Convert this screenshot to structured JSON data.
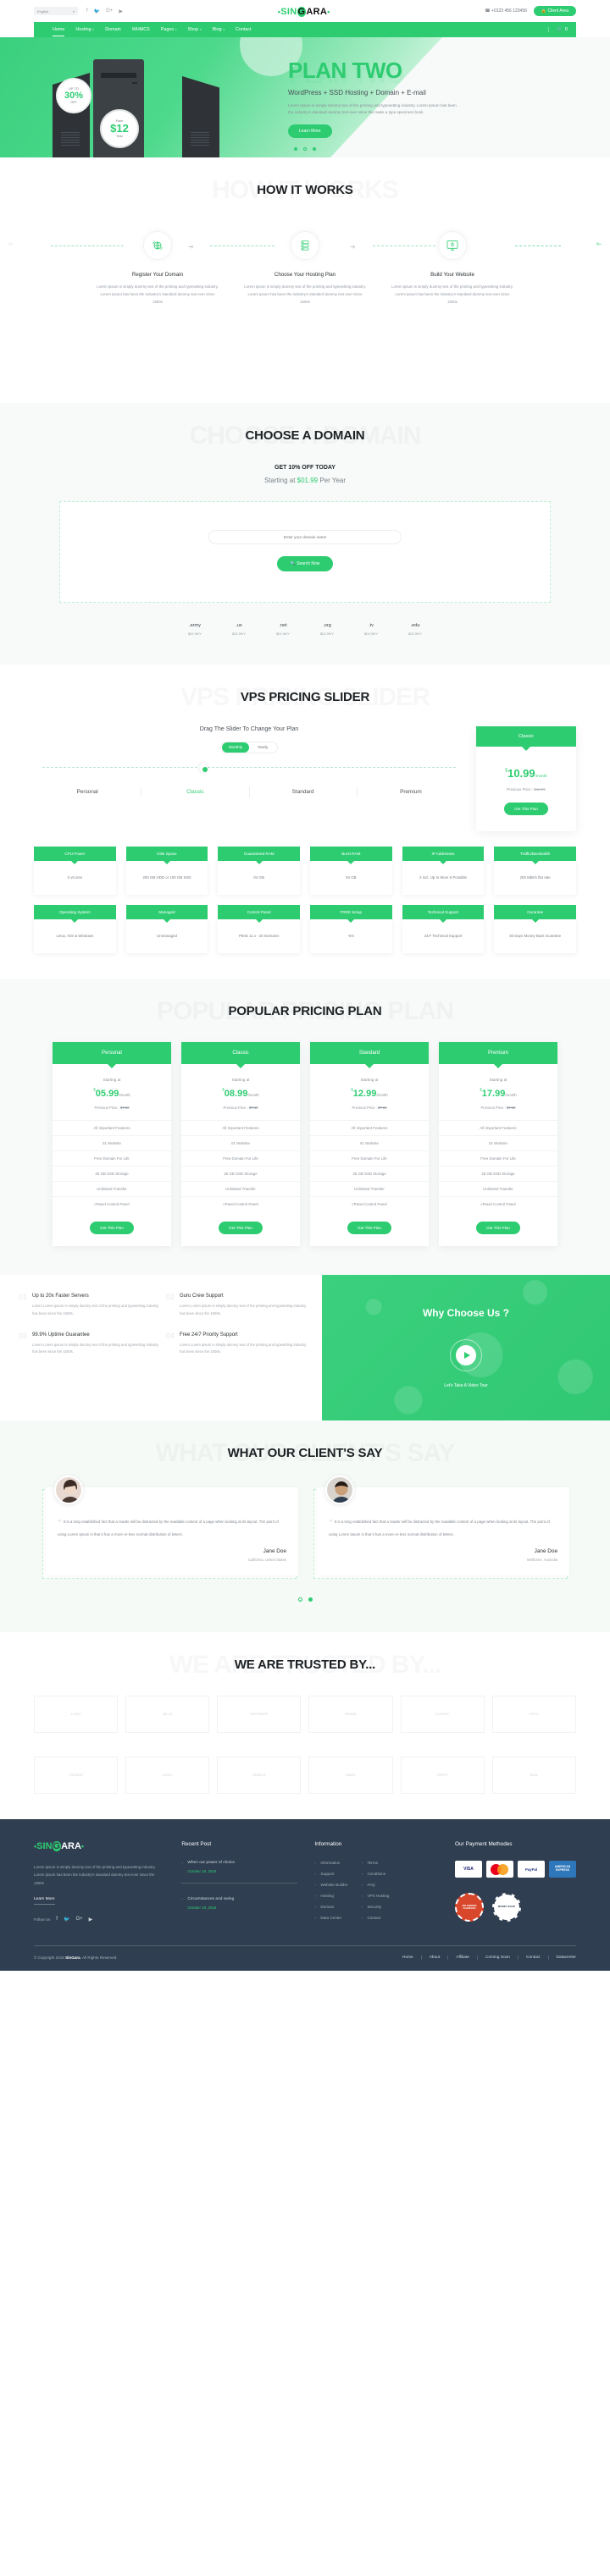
{
  "topbar": {
    "language": "English",
    "social": [
      "facebook-icon",
      "twitter-icon",
      "google-plus-icon",
      "youtube-icon"
    ],
    "phone": "+0123 456 123456",
    "client_area": "Client Area"
  },
  "brand": {
    "dot": "•",
    "sin": "SIN",
    "g": "G",
    "ara": "ARA"
  },
  "nav": {
    "items": [
      {
        "label": "Home",
        "caret": false,
        "active": true
      },
      {
        "label": "Hosting",
        "caret": true,
        "active": false
      },
      {
        "label": "Domain",
        "caret": false,
        "active": false
      },
      {
        "label": "WHMCS",
        "caret": false,
        "active": false
      },
      {
        "label": "Pages",
        "caret": true,
        "active": false
      },
      {
        "label": "Shop",
        "caret": true,
        "active": false
      },
      {
        "label": "Blog",
        "caret": true,
        "active": false
      },
      {
        "label": "Contact",
        "caret": false,
        "active": false
      }
    ],
    "cart_count": "0"
  },
  "hero": {
    "title": "PLAN TWO",
    "subtitle": "WordPress + SSD Hosting + Domain + E-mail",
    "description": "Lorem Ipsum is simply dummy text of the printing and typesetting industry. Lorem Ipsum has been the industry's standard dummy text ever since the make a type specimen book.",
    "button": "Learn More",
    "badge_off": {
      "top": "UP TO",
      "value": "30%",
      "bottom": "OFF"
    },
    "badge_price": {
      "top": "Form",
      "value": "$12",
      "bottom": "Year"
    }
  },
  "how": {
    "title": "HOW IT WORKS",
    "steps": [
      {
        "icon": "globe-refresh-icon",
        "name": "Register Your Domain",
        "desc": "Lorem ipsum is simply dummy text of the printing and typesetting industry. Lorem ipsum has been the industry's standard dummy text ever since 1500s"
      },
      {
        "icon": "server-list-icon",
        "name": "Choose Your Hosting Plan",
        "desc": "Lorem ipsum is simply dummy text of the printing and typesetting industry. Lorem ipsum has been the industry's standard dummy text ever since 1500s"
      },
      {
        "icon": "monitor-rocket-icon",
        "name": "Build Your Website",
        "desc": "Lorem ipsum is simply dummy text of the printing and typesetting industry. Lorem ipsum has been the industry's standard dummy text ever since 1500s"
      }
    ]
  },
  "domain": {
    "title": "CHOOSE A DOMAIN",
    "offer": "GET 10% OFF TODAY",
    "starting_prefix": "Starting at ",
    "starting_price": "$01.99",
    "starting_suffix": " Per Year",
    "input_placeholder": "Enter your domain name",
    "search_button": "Search Now",
    "tlds": [
      {
        "name": ".army",
        "price": "$02.99/Y"
      },
      {
        "name": ".us",
        "price": "$02.99/Y"
      },
      {
        "name": ".net",
        "price": "$02.99/Y"
      },
      {
        "name": ".org",
        "price": "$02.99/Y"
      },
      {
        "name": ".tv",
        "price": "$02.99/Y"
      },
      {
        "name": ".edu",
        "price": "$02.99/Y"
      }
    ]
  },
  "vps": {
    "title": "VPS PRICING SLIDER",
    "drag_text": "Drag The Slider To Change Your Plan",
    "toggle": {
      "monthly": "Monthly",
      "yearly": "Yearly",
      "active": "Monthly"
    },
    "plans": [
      "Personal",
      "Classic",
      "Standard",
      "Premium"
    ],
    "selected_plan": "Classic",
    "card": {
      "name": "Classic",
      "currency": "$",
      "price": "10.99",
      "period": "/month",
      "previous": "Previous Price : ",
      "previous_price": "$12.99",
      "button": "Get This Plan"
    },
    "features": [
      {
        "label": "CPU Power",
        "value": "2 vCores"
      },
      {
        "label": "Disk Space",
        "value": "200 GB HDD or 100 GB SSD"
      },
      {
        "label": "Guaranteed RAM",
        "value": "04 GB"
      },
      {
        "label": "Burst RAM",
        "value": "04 GB"
      },
      {
        "label": "IP Addresses",
        "value": "2 incl. Up to More 6 Possible"
      },
      {
        "label": "Traffic/Bandwidth",
        "value": "200 Mbit/s flat rate"
      },
      {
        "label": "Operating System",
        "value": "Linux, IOS & Windows"
      },
      {
        "label": "Managed",
        "value": "Unmanaged"
      },
      {
        "label": "Control Panel",
        "value": "Plesk 11.x - 20 Domains"
      },
      {
        "label": "FREE Setup",
        "value": "Yes"
      },
      {
        "label": "Technical Support",
        "value": "24/7 Technical Support"
      },
      {
        "label": "Gurantee",
        "value": "30 Days Money Back Gurantee"
      }
    ]
  },
  "popular": {
    "title": "POPULAR PRICING PLAN",
    "starting_label": "Starting at",
    "previous_label": "Previous Price : ",
    "previous_price": "$7.50",
    "button": "Get This Plan",
    "features": [
      "All Important Features",
      "01 Website",
      "Free Domain For Life",
      "25 GB SSD Storage",
      "Unlimited Transfer",
      "cPanel Control Panel"
    ],
    "plans": [
      {
        "name": "Personal",
        "currency": "$",
        "price": "05.99",
        "period": "/month"
      },
      {
        "name": "Classic",
        "currency": "$",
        "price": "08.99",
        "period": "/month"
      },
      {
        "name": "Standard",
        "currency": "$",
        "price": "12.99",
        "period": "/month"
      },
      {
        "name": "Premium",
        "currency": "$",
        "price": "17.99",
        "period": "/month"
      }
    ]
  },
  "why": {
    "title": "Why Choose Us ?",
    "cta": "Let's Take A Video Tour",
    "items": [
      {
        "num": "01",
        "title": "Up to 20x Faster Servers",
        "desc": "Lorem Lorem ipsum is simply dummy text of the printing and typesetting industry has been since the 1500s."
      },
      {
        "num": "02",
        "title": "Guru Crew Support",
        "desc": "Lorem Lorem ipsum is simply dummy text of the printing and typesetting industry has been since the 1500s."
      },
      {
        "num": "03",
        "title": "99.9% Uptime Guarantee",
        "desc": "Lorem Lorem ipsum is simply dummy text of the printing and typesetting industry has been since the 1500s."
      },
      {
        "num": "04",
        "title": "Free 24/7 Priority Support",
        "desc": "Lorem Lorem ipsum is simply dummy text of the printing and typesetting industry has been since the 1500s."
      }
    ]
  },
  "testimonials": {
    "title": "WHAT OUR CLIENT'S SAY",
    "items": [
      {
        "quote": "It is a long established fact that a reader will be distracted by the readable content of a page when looking at its layout. The point of using Lorem Ipsum is that it has a more-or-less normal distribution of letters.",
        "name": "Jane Doe",
        "location": "California, United States"
      },
      {
        "quote": "It is a long established fact that a reader will be distracted by the readable content of a page when looking at its layout. The point of using Lorem Ipsum is that it has a more-or-less normal distribution of letters.",
        "name": "Jane Doe",
        "location": "Melborne, Australia"
      }
    ]
  },
  "trusted": {
    "title": "WE ARE TRUSTED BY...",
    "logos": [
      "LOGO",
      "QILLS",
      "PARTNERS",
      "BRAND",
      "CLASSIC",
      "ESTD"
    ],
    "logos2": [
      "VINTAGE",
      "LOGO",
      "REBELS",
      "MARK",
      "CREST",
      "SEAL"
    ]
  },
  "footer": {
    "about": "Lorem ipsum is simply dummy text of the printing and typesetting industry. Lorem ipsum has been the industry's standard dummy text ever since the 1500s",
    "learn_more": "Learn More",
    "follow_label": "Follow Us",
    "recent_title": "Recent Post",
    "posts": [
      {
        "title": "When our power of choice",
        "date": "October 18, 2018"
      },
      {
        "title": "Circumstances and owing",
        "date": "October 18, 2018"
      }
    ],
    "information_title": "Information",
    "info_col1": [
      "Information",
      "Support",
      "Website Builder",
      "Hosting",
      "Domain",
      "Data Center"
    ],
    "info_col2": [
      "Terms",
      "Conditions",
      "FAQ",
      "VPS Hosting",
      "Security",
      "Contact"
    ],
    "payment_title": "Our Payment Methodes",
    "payments": [
      "VISA",
      "MasterCard",
      "PayPal",
      "AMERICAN EXPRESS"
    ],
    "seals": [
      "MONEY GUARANTEE NO HIDDEN CHARGES BEST GUARANTEE",
      "100% SATISFIED MONEY BACK GUARANTEE"
    ],
    "copyright_pre": "© Copyright 2018 ",
    "copyright_brand": "SinGara",
    "copyright_post": ". All Rights Reserved.",
    "bottom_nav": [
      "Home",
      "About",
      "Affiliate",
      "Coming Soon",
      "Contact",
      "Datacenter"
    ]
  },
  "colors": {
    "accent": "#2ecc71",
    "dark": "#2f3e50",
    "soft_bg": "#f7faf9"
  }
}
